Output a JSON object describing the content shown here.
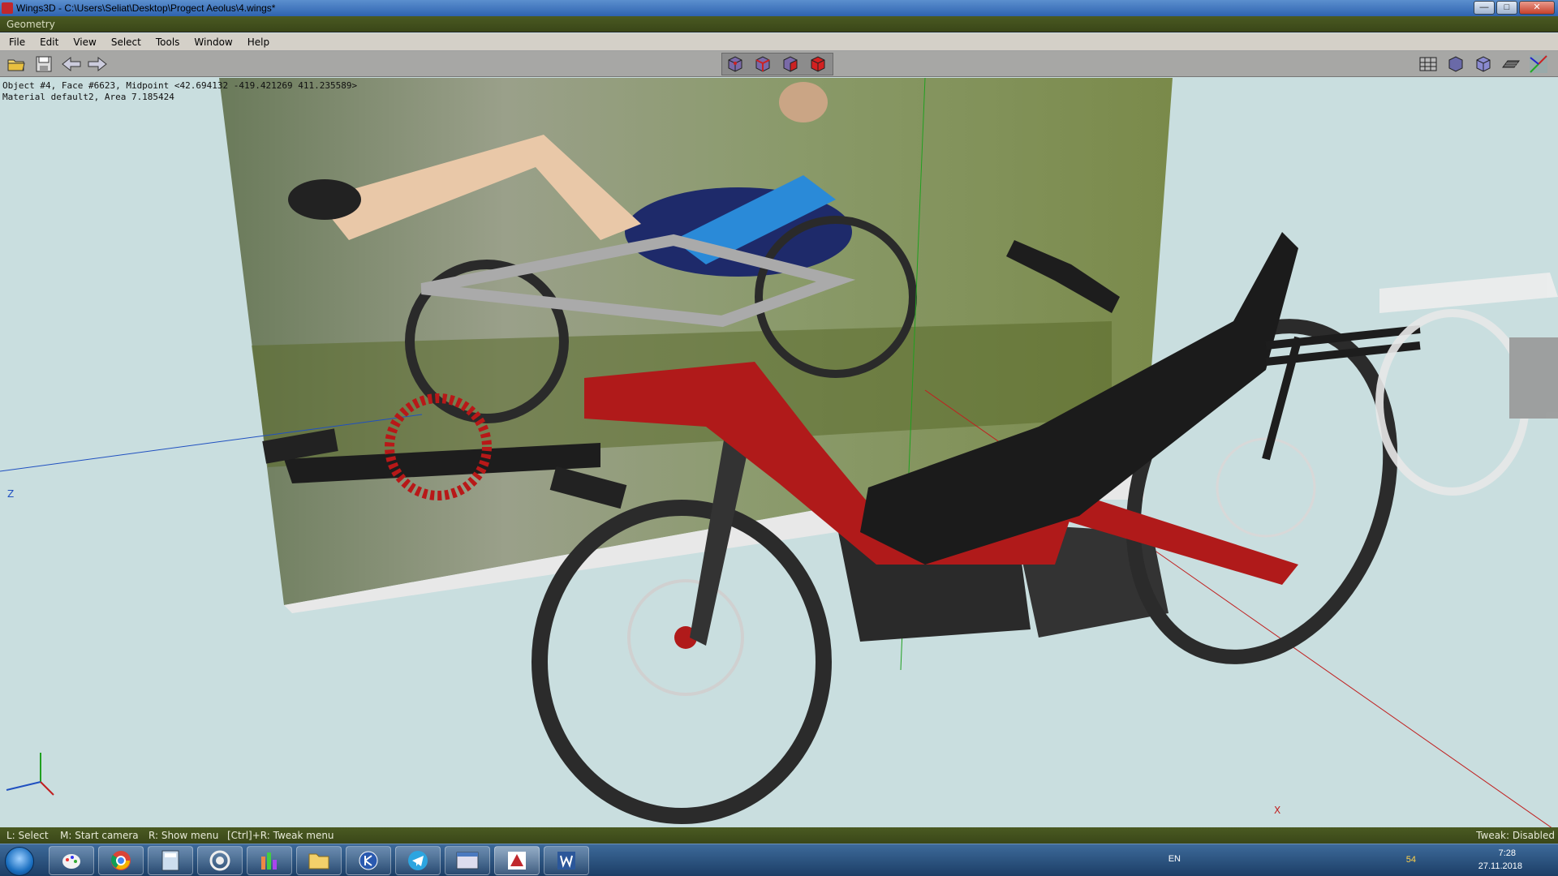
{
  "window": {
    "title": "Wings3D - C:\\Users\\Seliat\\Desktop\\Progect Aeolus\\4.wings*",
    "minimize": "—",
    "maximize": "□",
    "close": "✕"
  },
  "geometry_header": "Geometry",
  "menu": [
    "File",
    "Edit",
    "View",
    "Select",
    "Tools",
    "Window",
    "Help"
  ],
  "toolbar": {
    "left_icons": [
      "open-icon",
      "save-icon",
      "undo-icon",
      "redo-icon"
    ],
    "select_mode_icons": [
      "vertex-mode-icon",
      "edge-mode-icon",
      "face-mode-icon",
      "object-mode-icon"
    ],
    "right_icons": [
      "wireframe-toggle-icon",
      "smooth-shading-icon",
      "flat-shading-icon",
      "ground-plane-icon",
      "axes-icon"
    ]
  },
  "viewport": {
    "info_line1": "Object #4, Face #6623, Midpoint <42.694132 -419.421269 411.235589>",
    "info_line2": "Material default2, Area 7.185424",
    "axis_z": "Z",
    "axis_x": "X",
    "colors": {
      "background": "#c9dedf",
      "frame_red": "#b01a1a",
      "seat_black": "#1a1a1a",
      "x_axis": "#c02020",
      "z_axis": "#2050c0",
      "y_axis": "#20a020"
    }
  },
  "status": {
    "hints": [
      "L: Select",
      "M: Start camera",
      "R: Show menu",
      "[Ctrl]+R: Tweak menu"
    ],
    "tweak": "Tweak: Disabled"
  },
  "taskbar": {
    "apps": [
      "paint-icon",
      "chrome-icon",
      "calculator-icon",
      "cura-icon",
      "chart-app-icon",
      "folder-icon",
      "kompas-icon",
      "telegram-icon",
      "window-app-icon",
      "wings3d-icon",
      "word-icon"
    ],
    "active_app": "wings3d-icon",
    "language": "EN",
    "tray_count": "54",
    "clock_time": "7:28",
    "clock_date": "27.11.2018"
  }
}
